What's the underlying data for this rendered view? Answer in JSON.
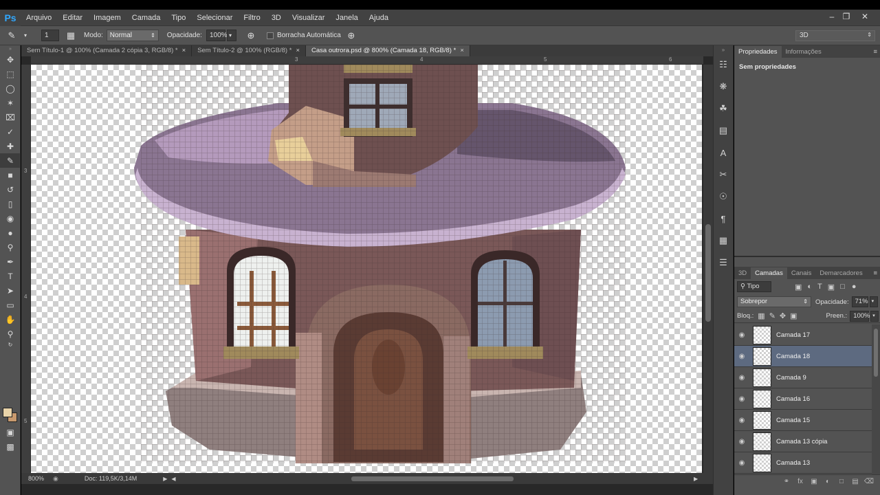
{
  "app": {
    "logo": "Ps"
  },
  "menu": [
    "Arquivo",
    "Editar",
    "Imagem",
    "Camada",
    "Tipo",
    "Selecionar",
    "Filtro",
    "3D",
    "Visualizar",
    "Janela",
    "Ajuda"
  ],
  "workspace": "3D",
  "options": {
    "brush_size": "1",
    "mode_label": "Modo:",
    "mode_value": "Normal",
    "opacity_label": "Opacidade:",
    "opacity_value": "100%",
    "auto_erase_label": "Borracha Automática"
  },
  "tabs": [
    {
      "label": "Sem Título-1 @ 100% (Camada 2 cópia 3, RGB/8) *",
      "active": false
    },
    {
      "label": "Sem Título-2 @ 100% (RGB/8) *",
      "active": false
    },
    {
      "label": "Casa outrora.psd @ 800% (Camada 18, RGB/8) *",
      "active": true
    }
  ],
  "ruler_top": [
    "3",
    "4",
    "5",
    "6"
  ],
  "ruler_left": [
    "3",
    "4",
    "5"
  ],
  "status": {
    "zoom": "800%",
    "doc": "Doc: 119,5K/3,14M"
  },
  "properties": {
    "tabs": [
      "Propriedades",
      "Informações"
    ],
    "body": "Sem propriedades"
  },
  "layers_panel": {
    "tabs": [
      "3D",
      "Camadas",
      "Canais",
      "Demarcadores"
    ],
    "filter": "Tipo",
    "blend_mode": "Sobrepor",
    "opacity_label": "Opacidade:",
    "opacity_value": "71%",
    "lock_label": "Bloq.:",
    "fill_label": "Preen.:",
    "fill_value": "100%",
    "layers": [
      {
        "name": "Camada 17",
        "selected": false
      },
      {
        "name": "Camada 18",
        "selected": true
      },
      {
        "name": "Camada 9",
        "selected": false
      },
      {
        "name": "Camada 16",
        "selected": false
      },
      {
        "name": "Camada 15",
        "selected": false
      },
      {
        "name": "Camada 13 cópia",
        "selected": false
      },
      {
        "name": "Camada 13",
        "selected": false
      }
    ]
  },
  "colors": {
    "foreground": "#e8d3a9",
    "background": "#c99a6e",
    "accent": "#31a8ff",
    "selected_layer": "#5d6a80"
  }
}
